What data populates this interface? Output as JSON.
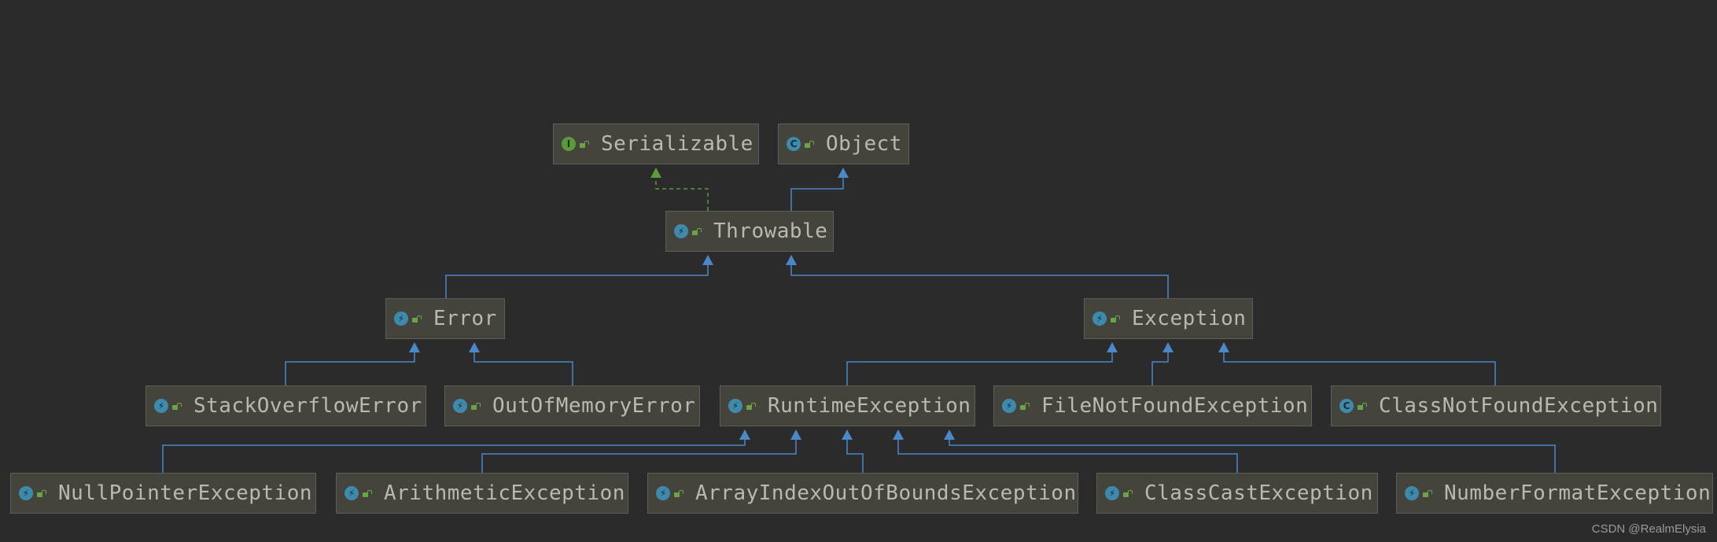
{
  "diagram": {
    "nodes": [
      {
        "id": "serializable",
        "label": "Serializable",
        "kind": "interface",
        "icon": "interface-icon"
      },
      {
        "id": "object",
        "label": "Object",
        "kind": "class",
        "icon": "class-icon"
      },
      {
        "id": "throwable",
        "label": "Throwable",
        "kind": "exception",
        "icon": "exception-class-icon"
      },
      {
        "id": "error",
        "label": "Error",
        "kind": "exception",
        "icon": "exception-class-icon"
      },
      {
        "id": "exception",
        "label": "Exception",
        "kind": "exception",
        "icon": "exception-class-icon"
      },
      {
        "id": "stackoverflowerror",
        "label": "StackOverflowError",
        "kind": "exception",
        "icon": "exception-class-icon"
      },
      {
        "id": "outofmemoryerror",
        "label": "OutOfMemoryError",
        "kind": "exception",
        "icon": "exception-class-icon"
      },
      {
        "id": "runtimeexception",
        "label": "RuntimeException",
        "kind": "exception",
        "icon": "exception-class-icon"
      },
      {
        "id": "filenotfoundexception",
        "label": "FileNotFoundException",
        "kind": "exception",
        "icon": "exception-class-icon"
      },
      {
        "id": "classnotfoundexception",
        "label": "ClassNotFoundException",
        "kind": "class",
        "icon": "class-icon"
      },
      {
        "id": "nullpointerexception",
        "label": "NullPointerException",
        "kind": "exception",
        "icon": "exception-class-icon"
      },
      {
        "id": "arithmeticexception",
        "label": "ArithmeticException",
        "kind": "exception",
        "icon": "exception-class-icon"
      },
      {
        "id": "arrayindexoutofboundsexception",
        "label": "ArrayIndexOutOfBoundsException",
        "kind": "exception",
        "icon": "exception-class-icon"
      },
      {
        "id": "classcastexception",
        "label": "ClassCastException",
        "kind": "exception",
        "icon": "exception-class-icon"
      },
      {
        "id": "numberformatexception",
        "label": "NumberFormatException",
        "kind": "exception",
        "icon": "exception-class-icon"
      }
    ],
    "edges": [
      {
        "from": "throwable",
        "to": "serializable",
        "type": "implements"
      },
      {
        "from": "throwable",
        "to": "object",
        "type": "extends"
      },
      {
        "from": "error",
        "to": "throwable",
        "type": "extends"
      },
      {
        "from": "exception",
        "to": "throwable",
        "type": "extends"
      },
      {
        "from": "stackoverflowerror",
        "to": "error",
        "type": "extends"
      },
      {
        "from": "outofmemoryerror",
        "to": "error",
        "type": "extends"
      },
      {
        "from": "runtimeexception",
        "to": "exception",
        "type": "extends"
      },
      {
        "from": "filenotfoundexception",
        "to": "exception",
        "type": "extends"
      },
      {
        "from": "classnotfoundexception",
        "to": "exception",
        "type": "extends"
      },
      {
        "from": "nullpointerexception",
        "to": "runtimeexception",
        "type": "extends"
      },
      {
        "from": "arithmeticexception",
        "to": "runtimeexception",
        "type": "extends"
      },
      {
        "from": "arrayindexoutofboundsexception",
        "to": "runtimeexception",
        "type": "extends"
      },
      {
        "from": "classcastexception",
        "to": "runtimeexception",
        "type": "extends"
      },
      {
        "from": "numberformatexception",
        "to": "runtimeexception",
        "type": "extends"
      }
    ],
    "colors": {
      "background": "#2b2b2b",
      "extends_edge": "#4a88c7",
      "implements_edge": "#5d9a3c",
      "node_fill": "#45443c",
      "node_text": "#b8b9b1"
    }
  },
  "watermark": "CSDN @RealmElysia"
}
